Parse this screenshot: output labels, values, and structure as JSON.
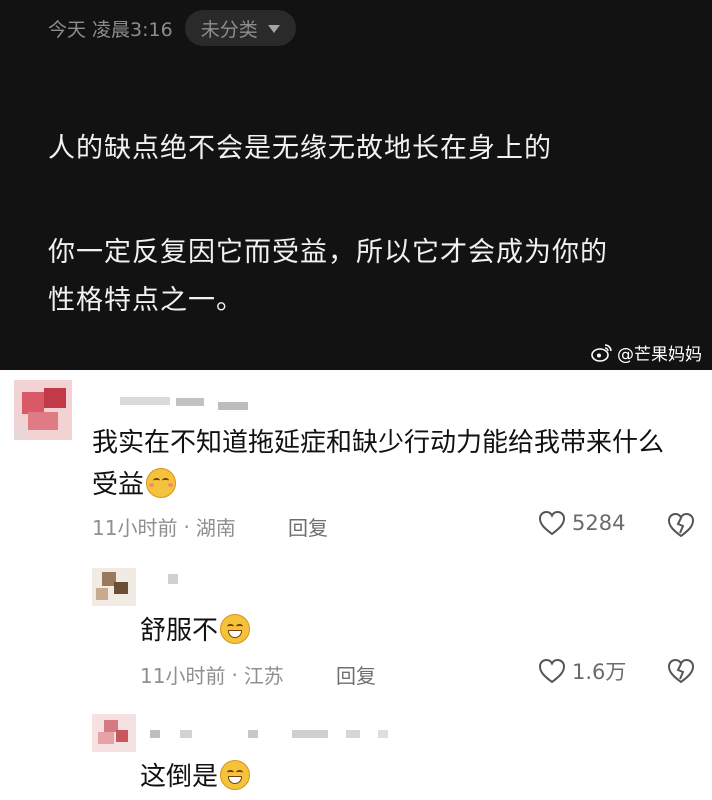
{
  "note": {
    "time": "今天 凌晨3:16",
    "category": "未分类",
    "lines": [
      "人的缺点绝不会是无缘无故地长在身上的",
      "你一定反复因它而受益，所以它才会成为你的",
      "性格特点之一。"
    ],
    "watermark": "@芒果妈妈"
  },
  "comments": [
    {
      "text1": "我实在不知道拖延症和缺少行动力能给我带来什么",
      "text2": "受益",
      "emoji": "smiling-face-emoji",
      "time": "11小时前",
      "location": "湖南",
      "reply": "回复",
      "likes": "5284"
    },
    {
      "text1": "舒服不",
      "emoji": "grinning-face-emoji",
      "time": "11小时前",
      "location": "江苏",
      "reply": "回复",
      "likes": "1.6万"
    },
    {
      "text1": "这倒是",
      "emoji": "grinning-face-emoji"
    }
  ],
  "colors": {
    "note_bg": "#121212",
    "note_text": "#f1f1f1",
    "meta_text": "#8d8d8d",
    "comment_text": "#111111",
    "info_text": "#8f8f8f"
  }
}
